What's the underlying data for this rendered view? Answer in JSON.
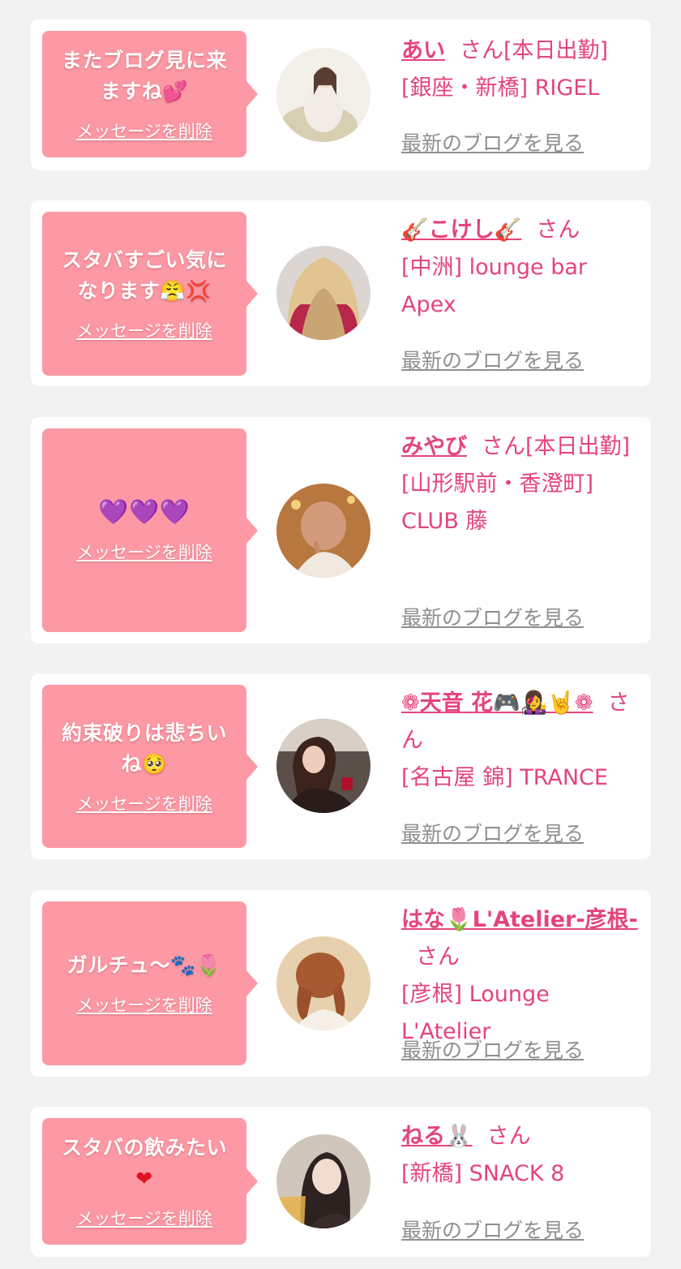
{
  "delete_label": "メッセージを削除",
  "blog_label": "最新のブログを見る",
  "san_label": "さん",
  "colors": {
    "background": "#f2f2f2",
    "card": "#ffffff",
    "bubble": "#fc99a5",
    "accent_pink": "#e4447a",
    "link_gray": "#8e8e8e"
  },
  "messages": [
    {
      "message_lines": [
        "またブログ見に来",
        "ますね💕"
      ],
      "name": "あい",
      "status": "[本日出勤]",
      "shop": "[銀座・新橋] RIGEL"
    },
    {
      "message_lines": [
        "スタバすごい気に",
        "なります😤💢"
      ],
      "name": "🎸こけし🎸",
      "status": "",
      "shop": "[中洲] lounge bar Apex"
    },
    {
      "message_lines": [
        "💜💜💜"
      ],
      "name": "みやび",
      "status": "[本日出勤]",
      "shop": "[山形駅前・香澄町] CLUB 藤"
    },
    {
      "message_lines": [
        "約束破りは悲ちい",
        "ね🥺"
      ],
      "name": "❁天音 花🎮👩‍🎤🤘❁",
      "status": "",
      "shop": "[名古屋 錦] TRANCE"
    },
    {
      "message_lines": [
        "ガルチュ〜🐾🌷"
      ],
      "name": "はな🌷L'Atelier-彦根-",
      "status": "",
      "shop": "[彦根] Lounge L'Atelier"
    },
    {
      "message_lines": [
        "スタバの飲みたい",
        "❤"
      ],
      "name": "ねる🐰",
      "status": "",
      "shop": "[新橋] SNACK 8"
    }
  ]
}
